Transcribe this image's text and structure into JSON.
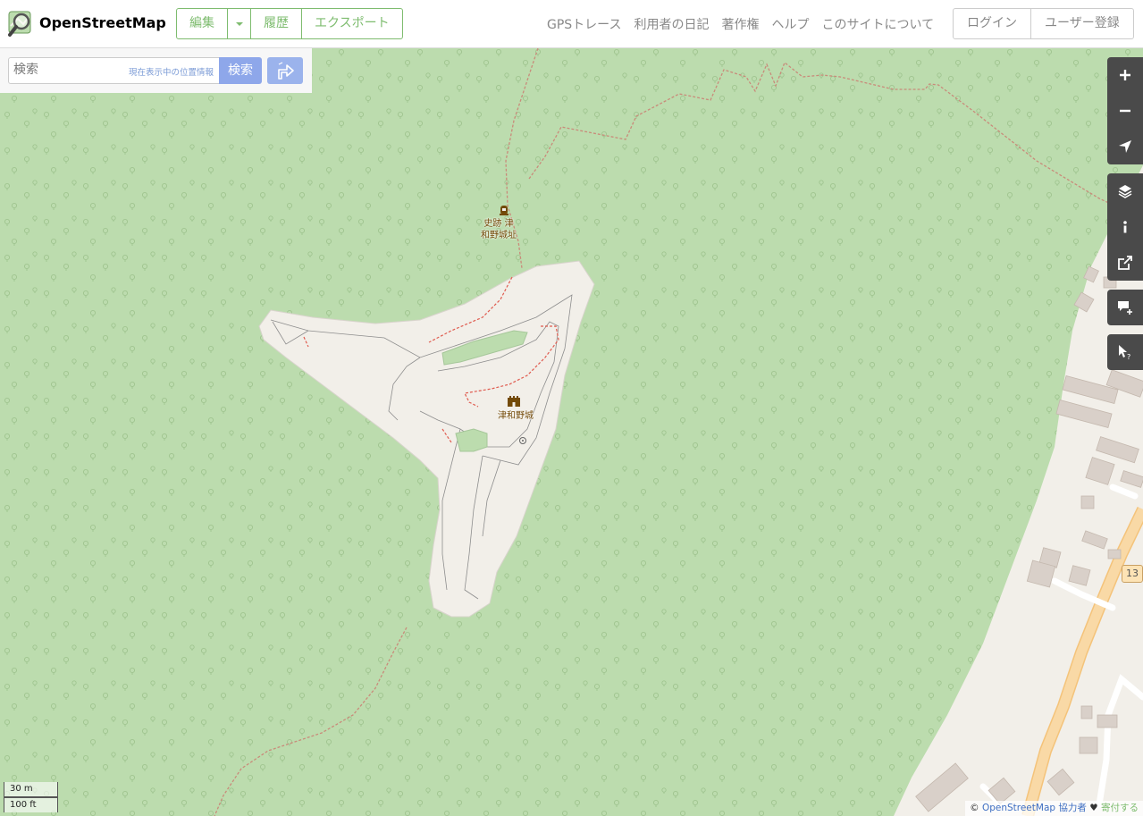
{
  "brand": {
    "name": "OpenStreetMap",
    "logo_icon": "magnifier-map-logo"
  },
  "edit_group": {
    "edit_label": "編集",
    "history_label": "履歴",
    "export_label": "エクスポート"
  },
  "nav": {
    "gps": "GPSトレース",
    "diaries": "利用者の日記",
    "copyright": "著作権",
    "help": "ヘルプ",
    "about": "このサイトについて"
  },
  "auth": {
    "login": "ログイン",
    "signup": "ユーザー登録"
  },
  "search": {
    "placeholder": "検索",
    "where_am_i": "現在表示中の位置情報",
    "button": "検索",
    "directions_icon": "directions-icon"
  },
  "map_controls": [
    "zoom-in-icon",
    "zoom-out-icon",
    "locate-icon",
    "layers-icon",
    "info-icon",
    "share-icon",
    "add-note-icon",
    "query-features-icon"
  ],
  "map_labels": {
    "historic_site": "史跡 津\n和野城址",
    "castle": "津和野城",
    "route_shield": "13"
  },
  "scale": {
    "metric": "30 m",
    "imperial": "100 ft"
  },
  "attribution": {
    "prefix": "©",
    "osm": "OpenStreetMap 協力者",
    "heart": "♥",
    "donate": "寄付する"
  },
  "colors": {
    "brand_green": "#7ebc6f",
    "forest": "#bcdcae",
    "landuse": "#f2efe9",
    "search_blue": "#8ea7ea",
    "control_dark": "#4a4a4a"
  }
}
